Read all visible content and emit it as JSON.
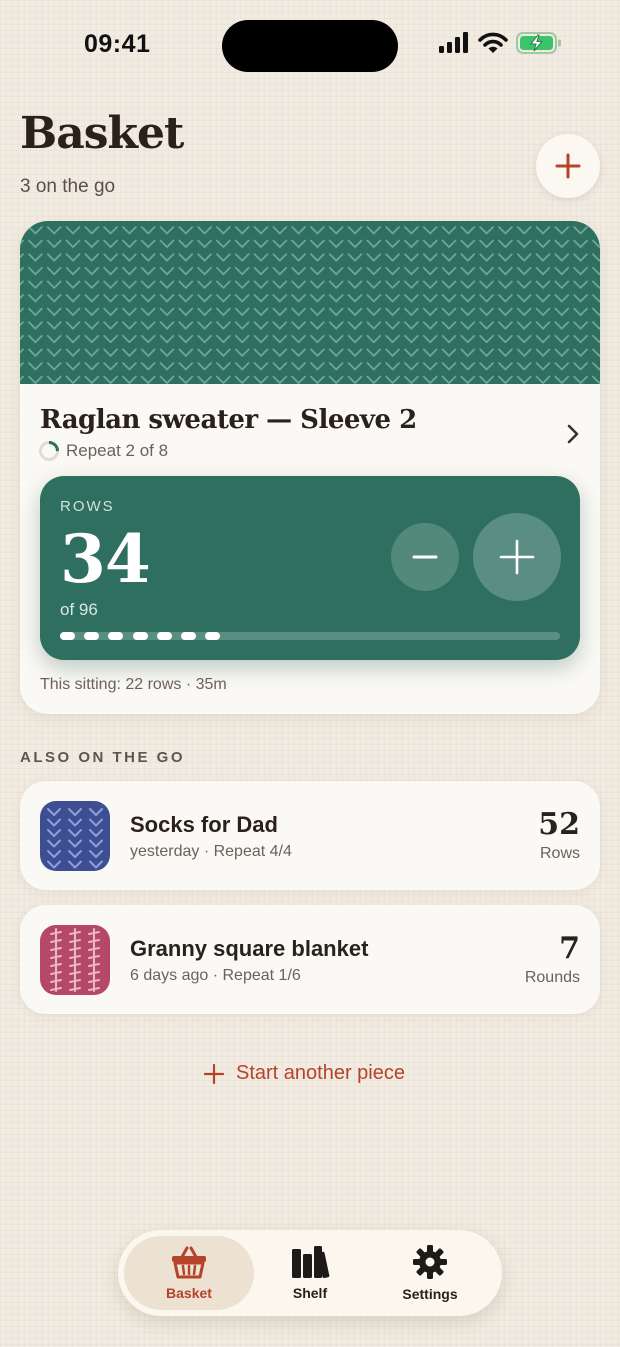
{
  "status_bar": {
    "time": "09:41"
  },
  "header": {
    "title": "Basket",
    "subtitle": "3 on the go"
  },
  "current_project": {
    "title": "Raglan sweater — Sleeve 2",
    "repeat": "Repeat 2 of 8",
    "repeat_progress": 0.25,
    "counter": {
      "label": "ROWS",
      "value": "34",
      "of_total": "of 96",
      "progress": 0.354
    },
    "sitting": "This sitting: 22 rows · 35m"
  },
  "section_label": "ALSO ON THE GO",
  "projects": [
    {
      "name": "Socks for Dad",
      "meta": "yesterday · Repeat 4/4",
      "count": "52",
      "unit": "Rows",
      "color": "#3d4f92",
      "mark_color": "#8fa0d8",
      "icon": "knit-v-pattern-icon"
    },
    {
      "name": "Granny square blanket",
      "meta": "6 days ago · Repeat 1/6",
      "count": "7",
      "unit": "Rounds",
      "color": "#b5486a",
      "mark_color": "#e8b9c6",
      "icon": "crochet-pattern-icon"
    }
  ],
  "start_action": "Start another piece",
  "tabs": [
    {
      "label": "Basket",
      "icon": "basket-icon",
      "active": true
    },
    {
      "label": "Shelf",
      "icon": "books-icon",
      "active": false
    },
    {
      "label": "Settings",
      "icon": "gear-icon",
      "active": false
    }
  ],
  "colors": {
    "accent": "#b5432b",
    "primary_green": "#2e6f5f",
    "background": "#f1ebe1"
  }
}
